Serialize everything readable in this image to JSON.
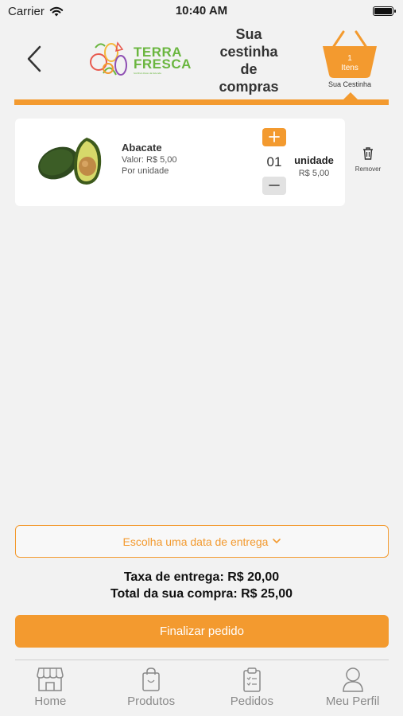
{
  "status_bar": {
    "carrier": "Carrier",
    "time": "10:40 AM"
  },
  "header": {
    "title": "Sua\ncestinha\nde\ncompras",
    "logo": {
      "line1": "TERRA",
      "line2": "FRESCA",
      "tagline": "hortifruti direto da fazenda"
    },
    "basket": {
      "count": "1",
      "count_unit": "Itens",
      "label": "Sua Cestinha"
    }
  },
  "cart": {
    "items": [
      {
        "name": "Abacate",
        "price": "Valor: R$ 5,00",
        "unit_info": "Por unidade",
        "quantity": "01",
        "unit": "unidade",
        "subtotal": "R$ 5,00",
        "remove_label": "Remover"
      }
    ]
  },
  "delivery": {
    "placeholder": "Escolha uma data de entrega"
  },
  "summary": {
    "fee": "Taxa de entrega: R$ 20,00",
    "total": "Total da sua compra: R$ 25,00"
  },
  "checkout": {
    "label": "Finalizar pedido"
  },
  "tabs": [
    {
      "label": "Home",
      "icon": "store-icon"
    },
    {
      "label": "Produtos",
      "icon": "shopping-bag-icon"
    },
    {
      "label": "Pedidos",
      "icon": "clipboard-icon"
    },
    {
      "label": "Meu Perfil",
      "icon": "user-icon"
    }
  ],
  "colors": {
    "accent": "#f39a2f",
    "background": "#f2f2f2",
    "logo_green": "#6ab63f"
  }
}
